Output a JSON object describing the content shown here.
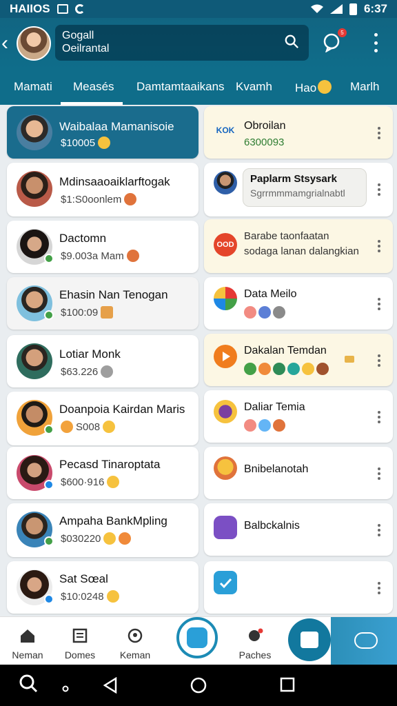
{
  "status_bar": {
    "left_text": "HAIIOS",
    "time": "6:37"
  },
  "app_bar": {
    "title_line1": "Gogall",
    "title_line2": "Oeilrantal",
    "notification_count": "5"
  },
  "tabs": [
    {
      "label": "Mamati"
    },
    {
      "label": "Measés"
    },
    {
      "label": "Damtamtaaikans"
    },
    {
      "label": "Kvamh"
    },
    {
      "label": "Hao"
    },
    {
      "label": "Marlh"
    }
  ],
  "left_list": [
    {
      "name": "Waibalaa Mamanisoie",
      "amount": "$10005"
    },
    {
      "name": "Mdinsaaoaiklarftogak",
      "amount": "$1:S0oonlem"
    },
    {
      "name": "Dactomn",
      "amount": "$9.003a Mam"
    },
    {
      "name": "Ehasin Nan Tenogan",
      "amount": "$100:09"
    },
    {
      "name": "Lotiar Monk",
      "amount": "$63.226"
    },
    {
      "name": "Doanpoia Kairdan Maris",
      "amount": "S008"
    },
    {
      "name": "Pecasd Tinaroptata",
      "amount": "$600·916"
    },
    {
      "name": "Ampaha BankMpling",
      "amount": "$030220"
    },
    {
      "name": "Sat Sœal",
      "amount": "$10:0248"
    }
  ],
  "right_list": [
    {
      "title": "Obroilan",
      "subtitle": "6300093",
      "logo_text": "KOK"
    },
    {
      "bubble_title": "Paplarm Stsysark",
      "bubble_text": "Sgrrmmmamgrialnabtl"
    },
    {
      "line1": "Barabe taonfaatan",
      "line2": "sodaga lanan dalangkian",
      "logo_text": "OOD"
    },
    {
      "title": "Data Meilo"
    },
    {
      "title": "Dakalan Temdan"
    },
    {
      "title": "Daliar Temia"
    },
    {
      "title": "Bnibelanotah"
    },
    {
      "title": "Balbckalnis"
    },
    {
      "title": ""
    }
  ],
  "bottom_nav": [
    {
      "label": "Neman"
    },
    {
      "label": "Domes"
    },
    {
      "label": "Keman"
    },
    {
      "label": "Paches"
    }
  ],
  "colors": {
    "primary": "#0f6d8a",
    "selected_card": "#1a6c8d",
    "accent": "#2a9fd8"
  }
}
